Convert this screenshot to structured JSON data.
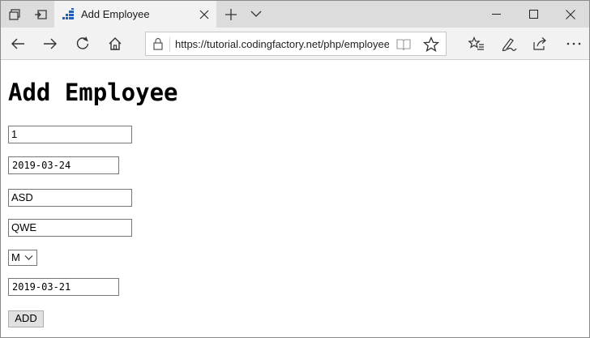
{
  "tab": {
    "title": "Add Employee"
  },
  "address": {
    "url": "https://tutorial.codingfactory.net/php/employee"
  },
  "page": {
    "heading": "Add Employee",
    "fields": {
      "emp_no": "1",
      "birth_date": "2019-03-24",
      "first_name": "ASD",
      "last_name": "QWE",
      "gender": "M",
      "hire_date": "2019-03-21"
    },
    "submit_label": "ADD"
  },
  "icons": {
    "tab_actions": "tab-actions-icon",
    "set_aside": "set-aside-tabs-icon",
    "favicon": "site-favicon-icon",
    "close_tab": "close-icon",
    "new_tab": "plus-icon",
    "tab_list": "chevron-down-icon",
    "minimize": "minimize-icon",
    "maximize": "maximize-icon",
    "close_window": "close-icon",
    "back": "back-arrow-icon",
    "forward": "forward-arrow-icon",
    "refresh": "refresh-icon",
    "home": "home-icon",
    "lock": "lock-icon",
    "reading_view": "reading-view-icon",
    "favorite": "star-icon",
    "favorites_hub": "favorites-hub-icon",
    "notes": "pen-icon",
    "share": "share-icon",
    "more": "more-icon"
  },
  "colors": {
    "tabbar_bg": "#dcdcdc",
    "active_tab_bg": "#f2f2f2",
    "favicon_blue": "#1f5fbf"
  }
}
